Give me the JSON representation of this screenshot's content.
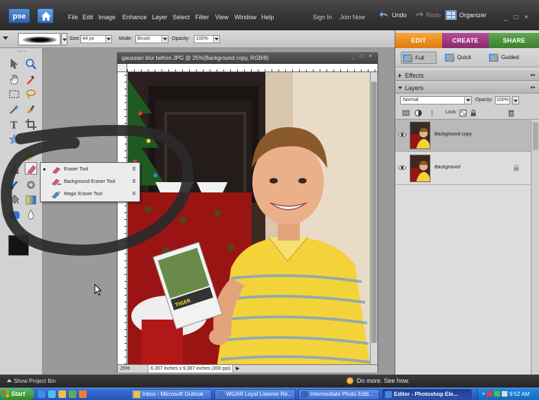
{
  "app": {
    "logo": "pse",
    "menus": [
      "File",
      "Edit",
      "Image",
      "Enhance",
      "Layer",
      "Select",
      "Filter",
      "View",
      "Window",
      "Help"
    ],
    "sign_in": "Sign In",
    "join_now": "Join Now",
    "undo": "Undo",
    "redo": "Redo",
    "organizer": "Organizer",
    "window_controls": [
      "_",
      "□",
      "×"
    ]
  },
  "options_bar": {
    "size_label": "Size:",
    "size_value": "44 px",
    "mode_label": "Mode:",
    "mode_value": "Brush",
    "opacity_label": "Opacity:",
    "opacity_value": "100%"
  },
  "document": {
    "title": "gaussian blur before.JPG @ 25%(Background copy, RGB/8)",
    "controls": [
      "_",
      "□",
      "×"
    ],
    "zoom": "25%",
    "info": "6.267 inches x 9.387 inches (300 ppi)",
    "info_arrow": "▶"
  },
  "flyout": {
    "items": [
      {
        "label": "Eraser Tool",
        "key": "E",
        "icon": "eraser-icon",
        "color": "#d0507a"
      },
      {
        "label": "Background Eraser Tool",
        "key": "E",
        "icon": "background-eraser-icon",
        "color": "#c45a8c"
      },
      {
        "label": "Magic Eraser Tool",
        "key": "E",
        "icon": "magic-eraser-icon",
        "color": "#5a7fc8"
      }
    ]
  },
  "right_panel": {
    "tabs": [
      "EDIT",
      "CREATE",
      "SHARE"
    ],
    "modes": [
      "Full",
      "Quick",
      "Guided"
    ],
    "effects_label": "Effects",
    "layers_label": "Layers",
    "blend_mode": "Normal",
    "opacity_label": "Opacity:",
    "opacity_value": "100%",
    "lock_label": "Lock:",
    "layers": [
      {
        "name": "Background copy",
        "selected": true,
        "italic": false
      },
      {
        "name": "Background",
        "selected": false,
        "italic": true
      }
    ]
  },
  "bin_bar": {
    "show_bin": "Show Project Bin",
    "do_more": "Do more. See how."
  },
  "taskbar": {
    "start": "Start",
    "tasks": [
      {
        "label": "Inbox - Microsoft Outlook",
        "active": false,
        "color": "#f0c040"
      },
      {
        "label": "WGAR Loyal Listener Re...",
        "active": false,
        "color": "#4a78c8"
      },
      {
        "label": "Intermediate Photo Editi...",
        "active": false,
        "color": "#3a62b0"
      },
      {
        "label": "Editor - Photoshop Ele...",
        "active": true,
        "color": "#4a86e0"
      }
    ],
    "tray_prefix": "«",
    "clock": "9:52 AM"
  },
  "colors": {
    "edit_tab": "#e98a1f",
    "create_tab": "#9d3580",
    "share_tab": "#4a9140",
    "foreground_swatch": "#141414",
    "annotation_scribble": "#2a2a2a"
  }
}
